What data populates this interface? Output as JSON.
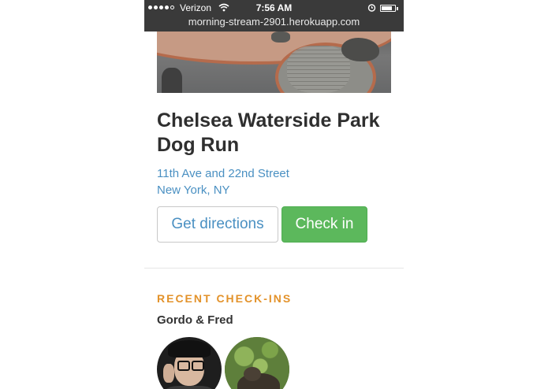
{
  "status_bar": {
    "carrier": "Verizon",
    "time": "7:56 AM",
    "url": "morning-stream-2901.herokuapp.com",
    "signal_bars_filled": 4,
    "signal_bars_total": 5,
    "battery_level": 0.75,
    "icons": [
      "signal-dots-icon",
      "wifi-icon",
      "alarm-icon",
      "battery-icon"
    ]
  },
  "park": {
    "name": "Chelsea Waterside Park Dog Run",
    "address_line1": "11th Ave and 22nd Street",
    "address_line2": "New York, NY"
  },
  "actions": {
    "directions_label": "Get directions",
    "checkin_label": "Check in"
  },
  "recent": {
    "heading": "RECENT CHECK-INS",
    "names": "Gordo & Fred"
  },
  "colors": {
    "link": "#4a90c2",
    "checkin_button": "#5cb85c",
    "heading_accent": "#e3922a",
    "status_bar": "#3a3a3a"
  }
}
